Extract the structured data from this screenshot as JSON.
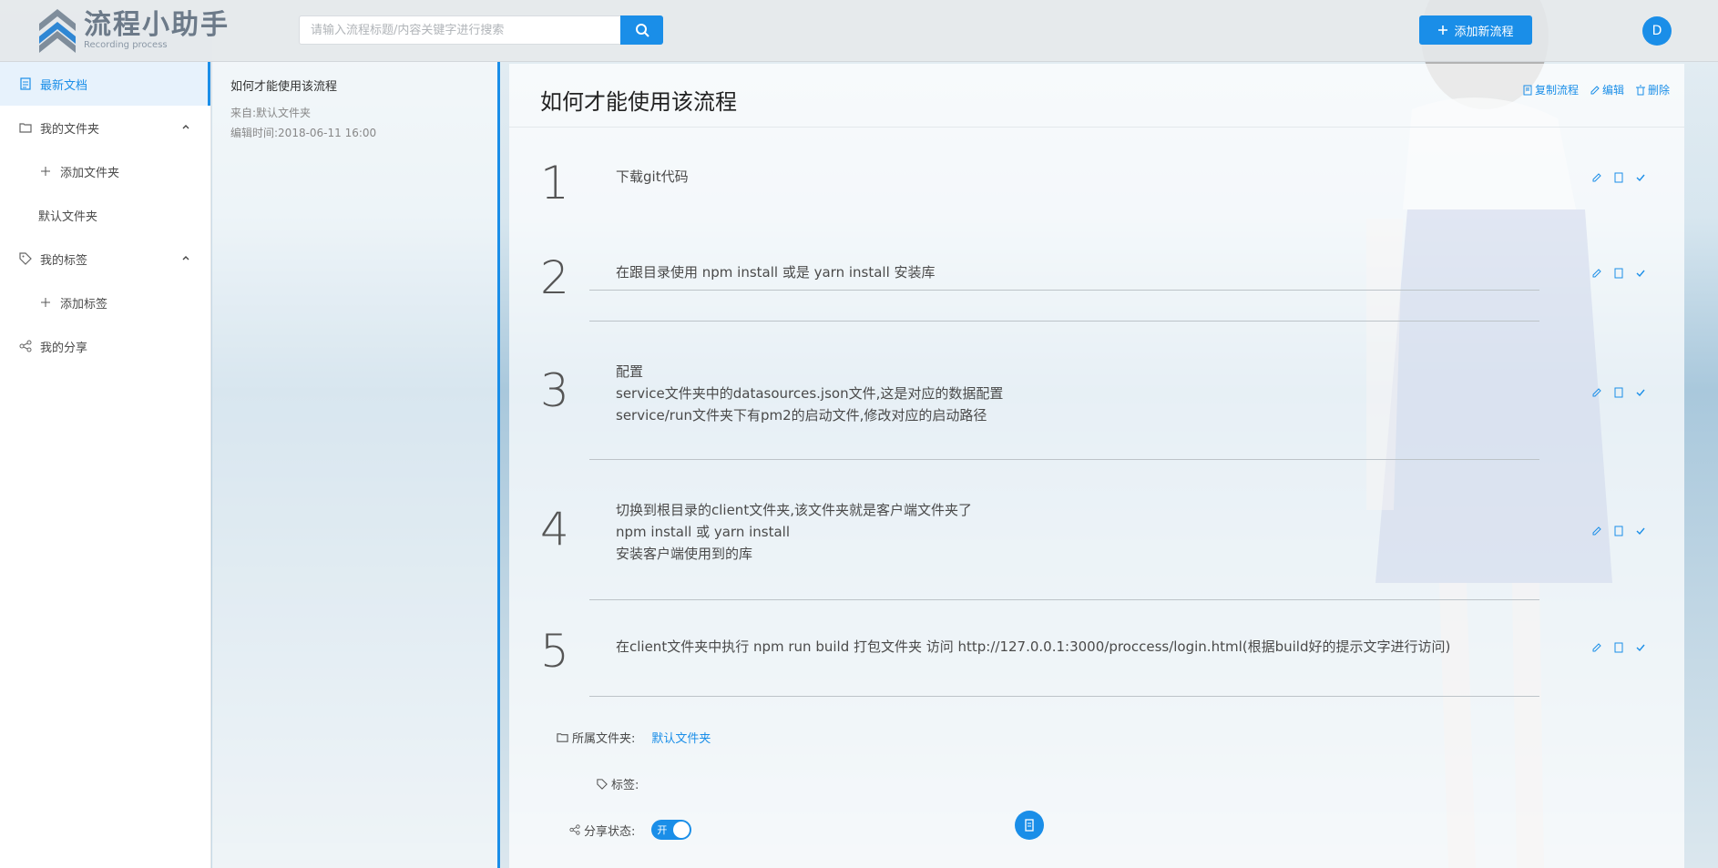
{
  "header": {
    "logo_title": "流程小助手",
    "logo_sub": "Recording process",
    "search_placeholder": "请输入流程标题/内容关键字进行搜索",
    "add_label": "添加新流程",
    "avatar_letter": "D"
  },
  "sidebar": {
    "items": [
      {
        "label": "最新文档",
        "icon": "document-icon",
        "active": true
      },
      {
        "label": "我的文件夹",
        "icon": "folder-icon"
      },
      {
        "label": "添加文件夹",
        "icon": "plus-icon"
      },
      {
        "label": "默认文件夹"
      },
      {
        "label": "我的标签",
        "icon": "tag-icon"
      },
      {
        "label": "添加标签",
        "icon": "plus-icon"
      },
      {
        "label": "我的分享",
        "icon": "share-icon"
      }
    ]
  },
  "doc_list": [
    {
      "title": "如何才能使用该流程",
      "source": "来自:默认文件夹",
      "edited": "编辑时间:2018-06-11 16:00"
    }
  ],
  "main": {
    "title": "如何才能使用该流程",
    "actions": {
      "copy": "复制流程",
      "edit": "编辑",
      "delete": "删除"
    },
    "steps": [
      {
        "num": "1",
        "lines": [
          "下载git代码"
        ]
      },
      {
        "num": "2",
        "lines": [
          "在跟目录使用 npm install 或是 yarn install 安装库"
        ]
      },
      {
        "num": "3",
        "lines": [
          "配置",
          "service文件夹中的datasources.json文件,这是对应的数据配置",
          "service/run文件夹下有pm2的启动文件,修改对应的启动路径"
        ]
      },
      {
        "num": "4",
        "lines": [
          "切换到根目录的client文件夹,该文件夹就是客户端文件夹了",
          "npm install 或 yarn install",
          "安装客户端使用到的库"
        ]
      },
      {
        "num": "5",
        "lines": [
          "在client文件夹中执行 npm run build 打包文件夹 访问 http://127.0.0.1:3000/proccess/login.html(根据build好的提示文字进行访问)"
        ]
      }
    ],
    "folder_label": "所属文件夹:",
    "folder_value": "默认文件夹",
    "tags_label": "标签:",
    "share_label": "分享状态:",
    "share_toggle": "开"
  },
  "colors": {
    "accent": "#1a8ee8"
  }
}
